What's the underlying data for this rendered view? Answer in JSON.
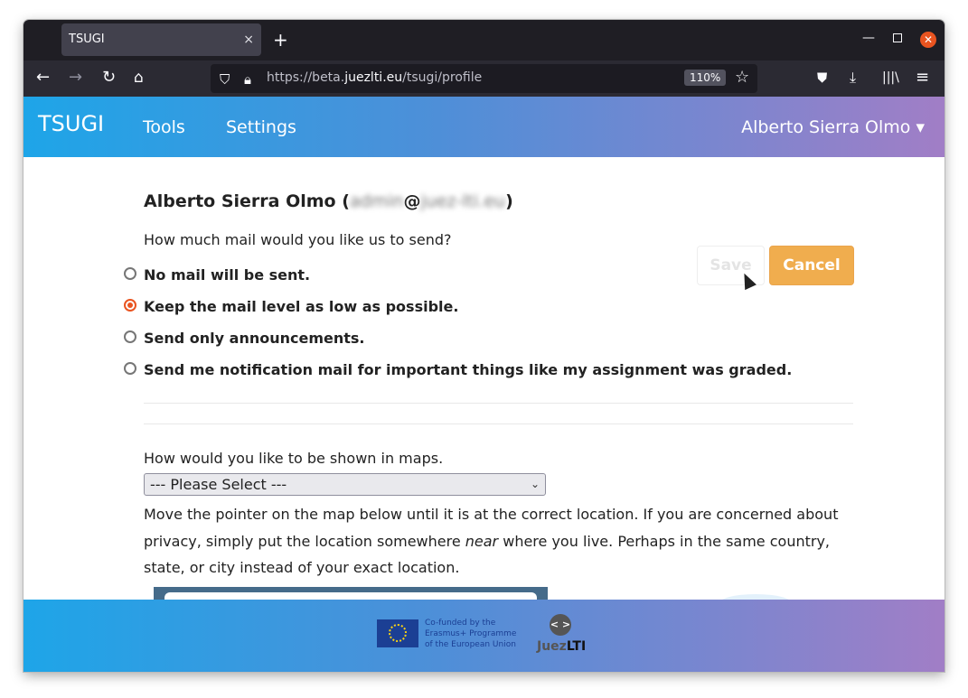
{
  "browser": {
    "tab_title": "TSUGI",
    "tab_close": "×",
    "new_tab": "+",
    "url_prefix": "https://beta.",
    "url_domain": "juezlti.eu",
    "url_path": "/tsugi/profile",
    "zoom": "110%"
  },
  "header": {
    "brand": "TSUGI",
    "nav": [
      "Tools",
      "Settings"
    ],
    "user": "Alberto Sierra Olmo ▾"
  },
  "profile": {
    "name": "Alberto Sierra Olmo (",
    "email_user": "admin",
    "email_at": "@",
    "email_domain": "juez-lti.eu",
    "close_paren": ")",
    "mail_question": "How much mail would you like us to send?",
    "mail_options": [
      {
        "label": "No mail will be sent.",
        "selected": false
      },
      {
        "label": "Keep the mail level as low as possible.",
        "selected": true
      },
      {
        "label": "Send only announcements.",
        "selected": false
      },
      {
        "label": "Send me notification mail for important things like my assignment was graded.",
        "selected": false
      }
    ],
    "save_label": "Save",
    "cancel_label": "Cancel",
    "maps_question": "How would you like to be shown in maps.",
    "maps_select": "--- Please Select ---",
    "map_instructions_1": "Move the pointer on the map below until it is at the correct location. If you are concerned about privacy, simply put the location somewhere ",
    "map_instructions_em": "near",
    "map_instructions_2": " where you live. Perhaps in the same country, state, or city instead of your exact location."
  },
  "footer": {
    "eu_text": "Co-funded by the Erasmus+ Programme of the European Union",
    "juez_symbol": "< >",
    "juez_brand_1": "Juez",
    "juez_brand_2": "LTI"
  },
  "colors": {
    "accent": "#e95420",
    "cancel": "#f0ad4e",
    "gradient_start": "#1ea5e8",
    "gradient_end": "#a17ec6"
  }
}
